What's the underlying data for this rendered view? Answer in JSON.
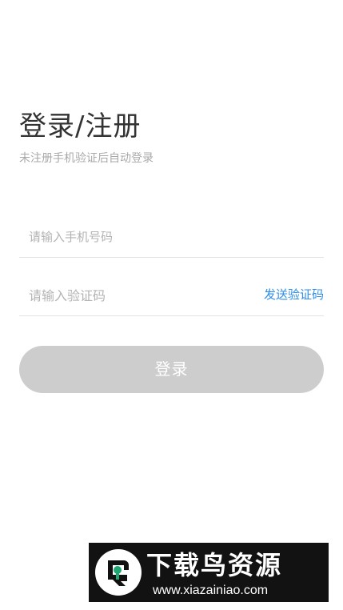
{
  "header": {
    "title": "登录/注册",
    "subtitle": "未注册手机验证后自动登录"
  },
  "form": {
    "phone_placeholder": "请输入手机号码",
    "code_placeholder": "请输入验证码",
    "send_code_label": "发送验证码",
    "login_label": "登录"
  },
  "watermark": {
    "title": "下载鸟资源",
    "url": "www.xiazainiao.com"
  },
  "colors": {
    "title": "#333333",
    "subtitle": "#a9a9a9",
    "link": "#2f8ee8",
    "button_disabled": "#cdcdcd",
    "divider": "#e3e3e3"
  }
}
